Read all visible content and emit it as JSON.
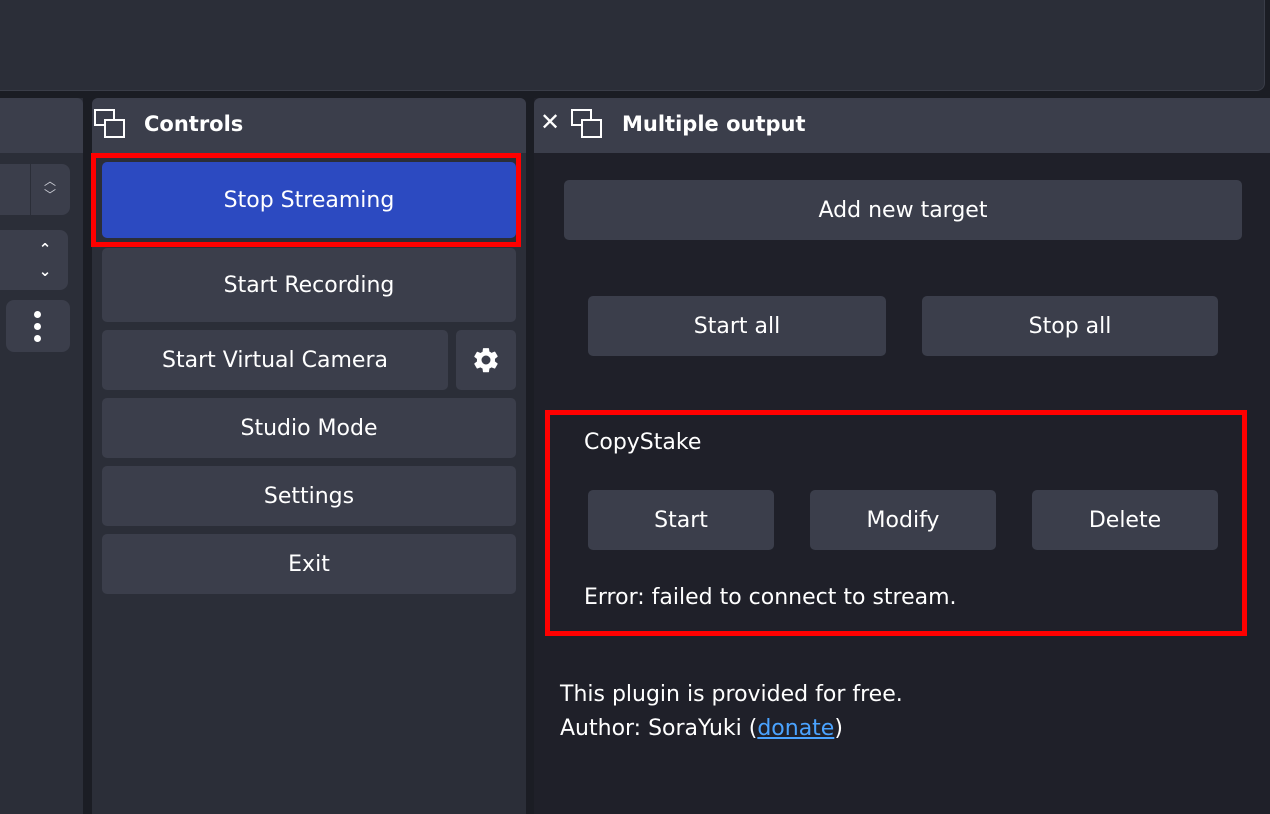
{
  "controls": {
    "title": "Controls",
    "stop_streaming": "Stop Streaming",
    "start_recording": "Start Recording",
    "start_virtual_camera": "Start Virtual Camera",
    "studio_mode": "Studio Mode",
    "settings": "Settings",
    "exit": "Exit"
  },
  "multiple_output": {
    "title": "Multiple output",
    "add_new_target": "Add new target",
    "start_all": "Start all",
    "stop_all": "Stop all",
    "target": {
      "name": "CopyStake",
      "start": "Start",
      "modify": "Modify",
      "delete": "Delete",
      "status": "Error: failed to connect to stream."
    },
    "footer": {
      "line1": "This plugin is provided for free.",
      "author_prefix": "Author: SoraYuki (",
      "donate_link": "donate",
      "author_suffix": ")"
    }
  },
  "icons": {
    "float": "float-window-icon",
    "close": "close-icon",
    "gear": "gear-icon",
    "kebab": "kebab-menu-icon"
  },
  "colors": {
    "accent": "#2c4ac1",
    "highlight": "#ff0000",
    "link": "#4aa3ff"
  }
}
